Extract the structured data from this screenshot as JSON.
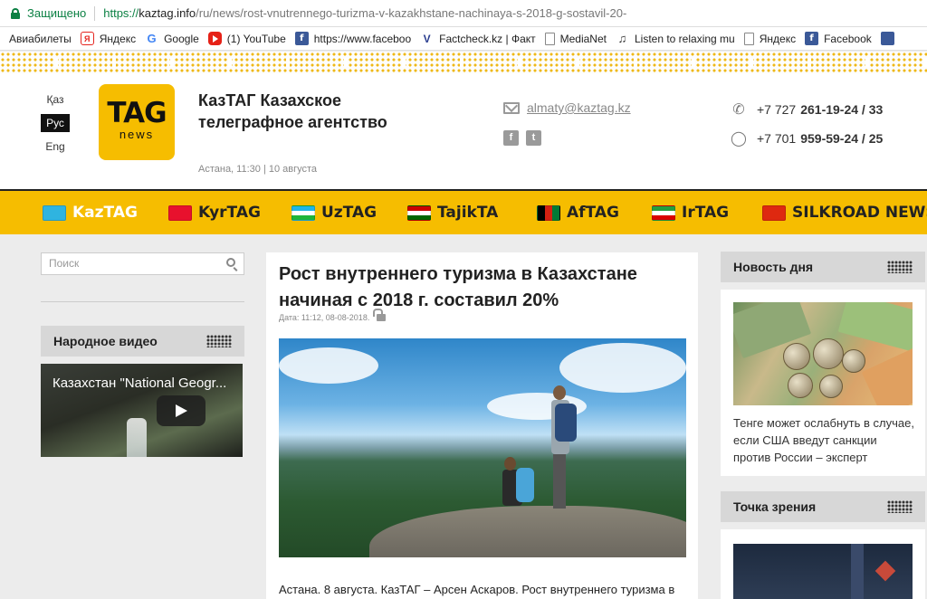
{
  "browser": {
    "secure_label": "Защищено",
    "url_proto": "https://",
    "url_host": "kaztag.info",
    "url_path": "/ru/news/rost-vnutrennego-turizma-v-kazakhstane-nachinaya-s-2018-g-sostavil-20-"
  },
  "bookmarks": [
    {
      "label": "Авиабилеты",
      "icon": "none"
    },
    {
      "label": "Яндекс",
      "icon": "yandex-icon"
    },
    {
      "label": "Google",
      "icon": "google-icon"
    },
    {
      "label": "(1) YouTube",
      "icon": "youtube-icon"
    },
    {
      "label": "https://www.faceboo",
      "icon": "facebook-icon"
    },
    {
      "label": "Factcheck.kz | Факт",
      "icon": "factcheck-icon"
    },
    {
      "label": "MediaNet",
      "icon": "page-icon"
    },
    {
      "label": "Listen to relaxing mu",
      "icon": "music-icon"
    },
    {
      "label": "Яндекс",
      "icon": "page-icon"
    },
    {
      "label": "Facebook",
      "icon": "facebook-icon"
    }
  ],
  "header": {
    "lang": [
      "Қаз",
      "Рус",
      "Eng"
    ],
    "active_lang": "Рус",
    "logo_top": "TAG",
    "logo_bottom": "news",
    "site_name": "КазТАГ Казахское телеграфное агентство",
    "dateline": "Астана, 11:30 | 10 августа",
    "email": "almaty@kaztag.kz",
    "phone1_prefix": "+7 727",
    "phone1_number": "261-19-24 / 33",
    "phone2_prefix": "+7 701",
    "phone2_number": "959-59-24 / 25"
  },
  "nav": [
    {
      "label": "KazTAG",
      "flag": "kz"
    },
    {
      "label": "KyrTAG",
      "flag": "kg"
    },
    {
      "label": "UzTAG",
      "flag": "uz"
    },
    {
      "label": "TajikTA",
      "flag": "tj"
    },
    {
      "label": "AfTAG",
      "flag": "af"
    },
    {
      "label": "IrTAG",
      "flag": "ir"
    },
    {
      "label": "SILKROAD NEWS",
      "flag": "cn"
    }
  ],
  "sidebar_left": {
    "search_placeholder": "Поиск",
    "video_heading": "Народное видео",
    "video_title": "Казахстан \"National Geogr..."
  },
  "article": {
    "title": "Рост внутреннего туризма в Казахстане начиная с 2018 г. составил 20%",
    "meta": "Дата: 11:12, 08-08-2018.",
    "lead": "Астана. 8 августа. КазТАГ – Арсен Аскаров. Рост внутреннего туризма в"
  },
  "sidebar_right": {
    "news_heading": "Новость дня",
    "news_caption": "Тенге может ослабнуть в случае, если США введут санкции против России – эксперт",
    "view_heading": "Точка зрения"
  },
  "colors": {
    "brand_yellow": "#f6bd00",
    "secure_green": "#0b8043"
  }
}
